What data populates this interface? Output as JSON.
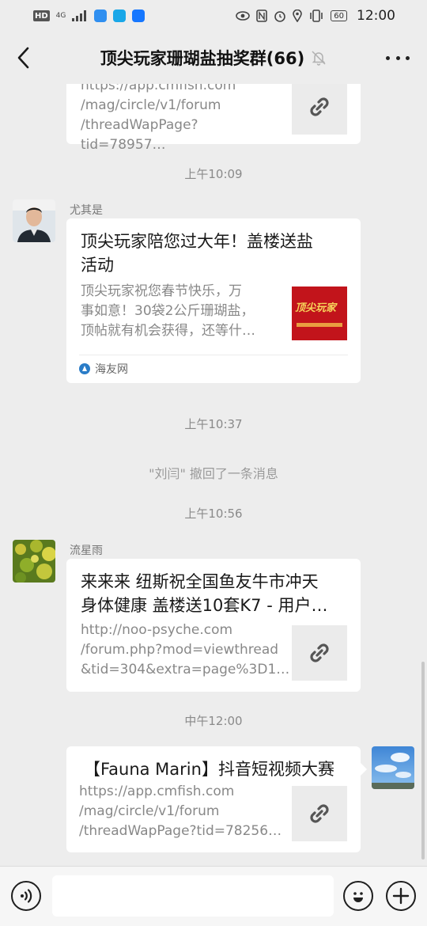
{
  "status_bar": {
    "network_badge": "HD",
    "network_type": "4G",
    "battery": "60",
    "time": "12:00"
  },
  "header": {
    "title": "顶尖玩家珊瑚盐抽奖群(66)"
  },
  "messages": {
    "m1": {
      "desc_lines": [
        "https://app.cmfish.com",
        "/mag/circle/v1/forum",
        "/threadWapPage?tid=78957…"
      ]
    },
    "t1": "上午10:09",
    "m2": {
      "sender": "尤其是",
      "title_lines": [
        "顶尖玩家陪您过大年！盖楼送盐",
        "活动"
      ],
      "desc_lines": [
        "顶尖玩家祝您春节快乐，万",
        "事如意！30袋2公斤珊瑚盐，",
        "顶帖就有机会获得，还等什…"
      ],
      "source": "海友网",
      "thumb_text": "顶尖玩家"
    },
    "t2": "上午10:37",
    "recall": "\"刘闫\" 撤回了一条消息",
    "t3": "上午10:56",
    "m3": {
      "sender": "流星雨",
      "title_lines": [
        "来来来 纽斯祝全国鱼友牛市冲天",
        "身体健康 盖楼送10套K7 - 用户…"
      ],
      "desc_lines": [
        "http://noo-psyche.com",
        "/forum.php?mod=viewthread",
        "&tid=304&extra=page%3D1…"
      ]
    },
    "t4": "中午12:00",
    "m4": {
      "title": "【Fauna Marin】抖音短视频大赛",
      "desc_lines": [
        "https://app.cmfish.com",
        "/mag/circle/v1/forum",
        "/threadWapPage?tid=78256…"
      ]
    }
  },
  "colors": {
    "background": "#ededed",
    "bubble": "#ffffff",
    "muted_text": "#888888",
    "source_icon": "#2a7cc7"
  }
}
